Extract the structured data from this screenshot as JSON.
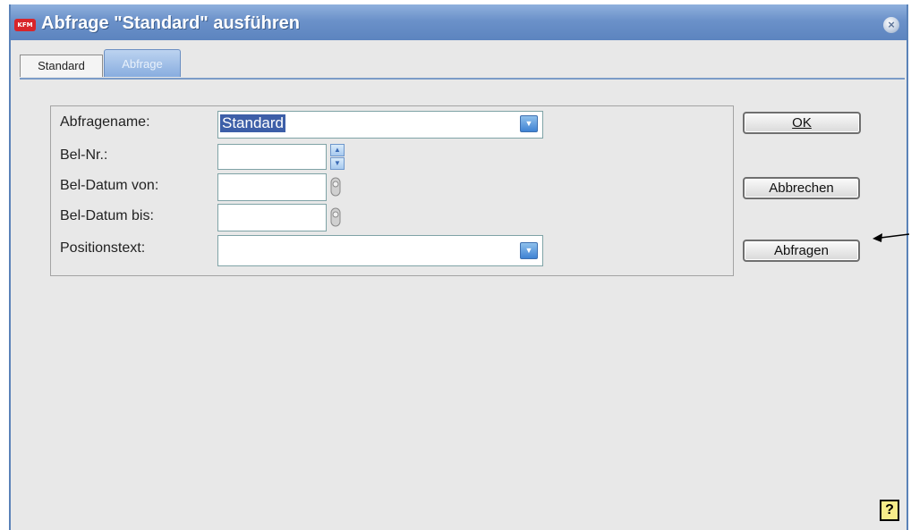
{
  "window": {
    "title": "Abfrage \"Standard\" ausführen",
    "logo": "KFM"
  },
  "tabs": [
    {
      "label": "Standard",
      "active": false
    },
    {
      "label": "Abfrage",
      "active": true
    }
  ],
  "form": {
    "abfragename": {
      "label": "Abfragename:",
      "value": "Standard"
    },
    "belnr": {
      "label": "Bel-Nr.:",
      "value": ""
    },
    "datum_von": {
      "label": "Bel-Datum von:",
      "value": ""
    },
    "datum_bis": {
      "label": "Bel-Datum bis:",
      "value": ""
    },
    "positionstext": {
      "label": "Positionstext:",
      "value": ""
    }
  },
  "buttons": {
    "ok": {
      "label": "OK",
      "mnemonic": "O"
    },
    "abbrechen": {
      "label": "Abbrechen",
      "mnemonic": "A"
    },
    "abfragen": {
      "label": "Abfragen",
      "mnemonic": "b"
    },
    "help": {
      "label": "?"
    }
  },
  "icons": {
    "close": "close-icon",
    "dropdown": "chevron-down-icon",
    "spinner": "spinner-icon",
    "calendar": "calendar-icon",
    "arrow": "arrow-left-icon"
  },
  "colors": {
    "titlebar": "#6b91c9",
    "tab_active": "#88addf",
    "selection": "#3d5fa8",
    "help": "#f7ed8a"
  }
}
